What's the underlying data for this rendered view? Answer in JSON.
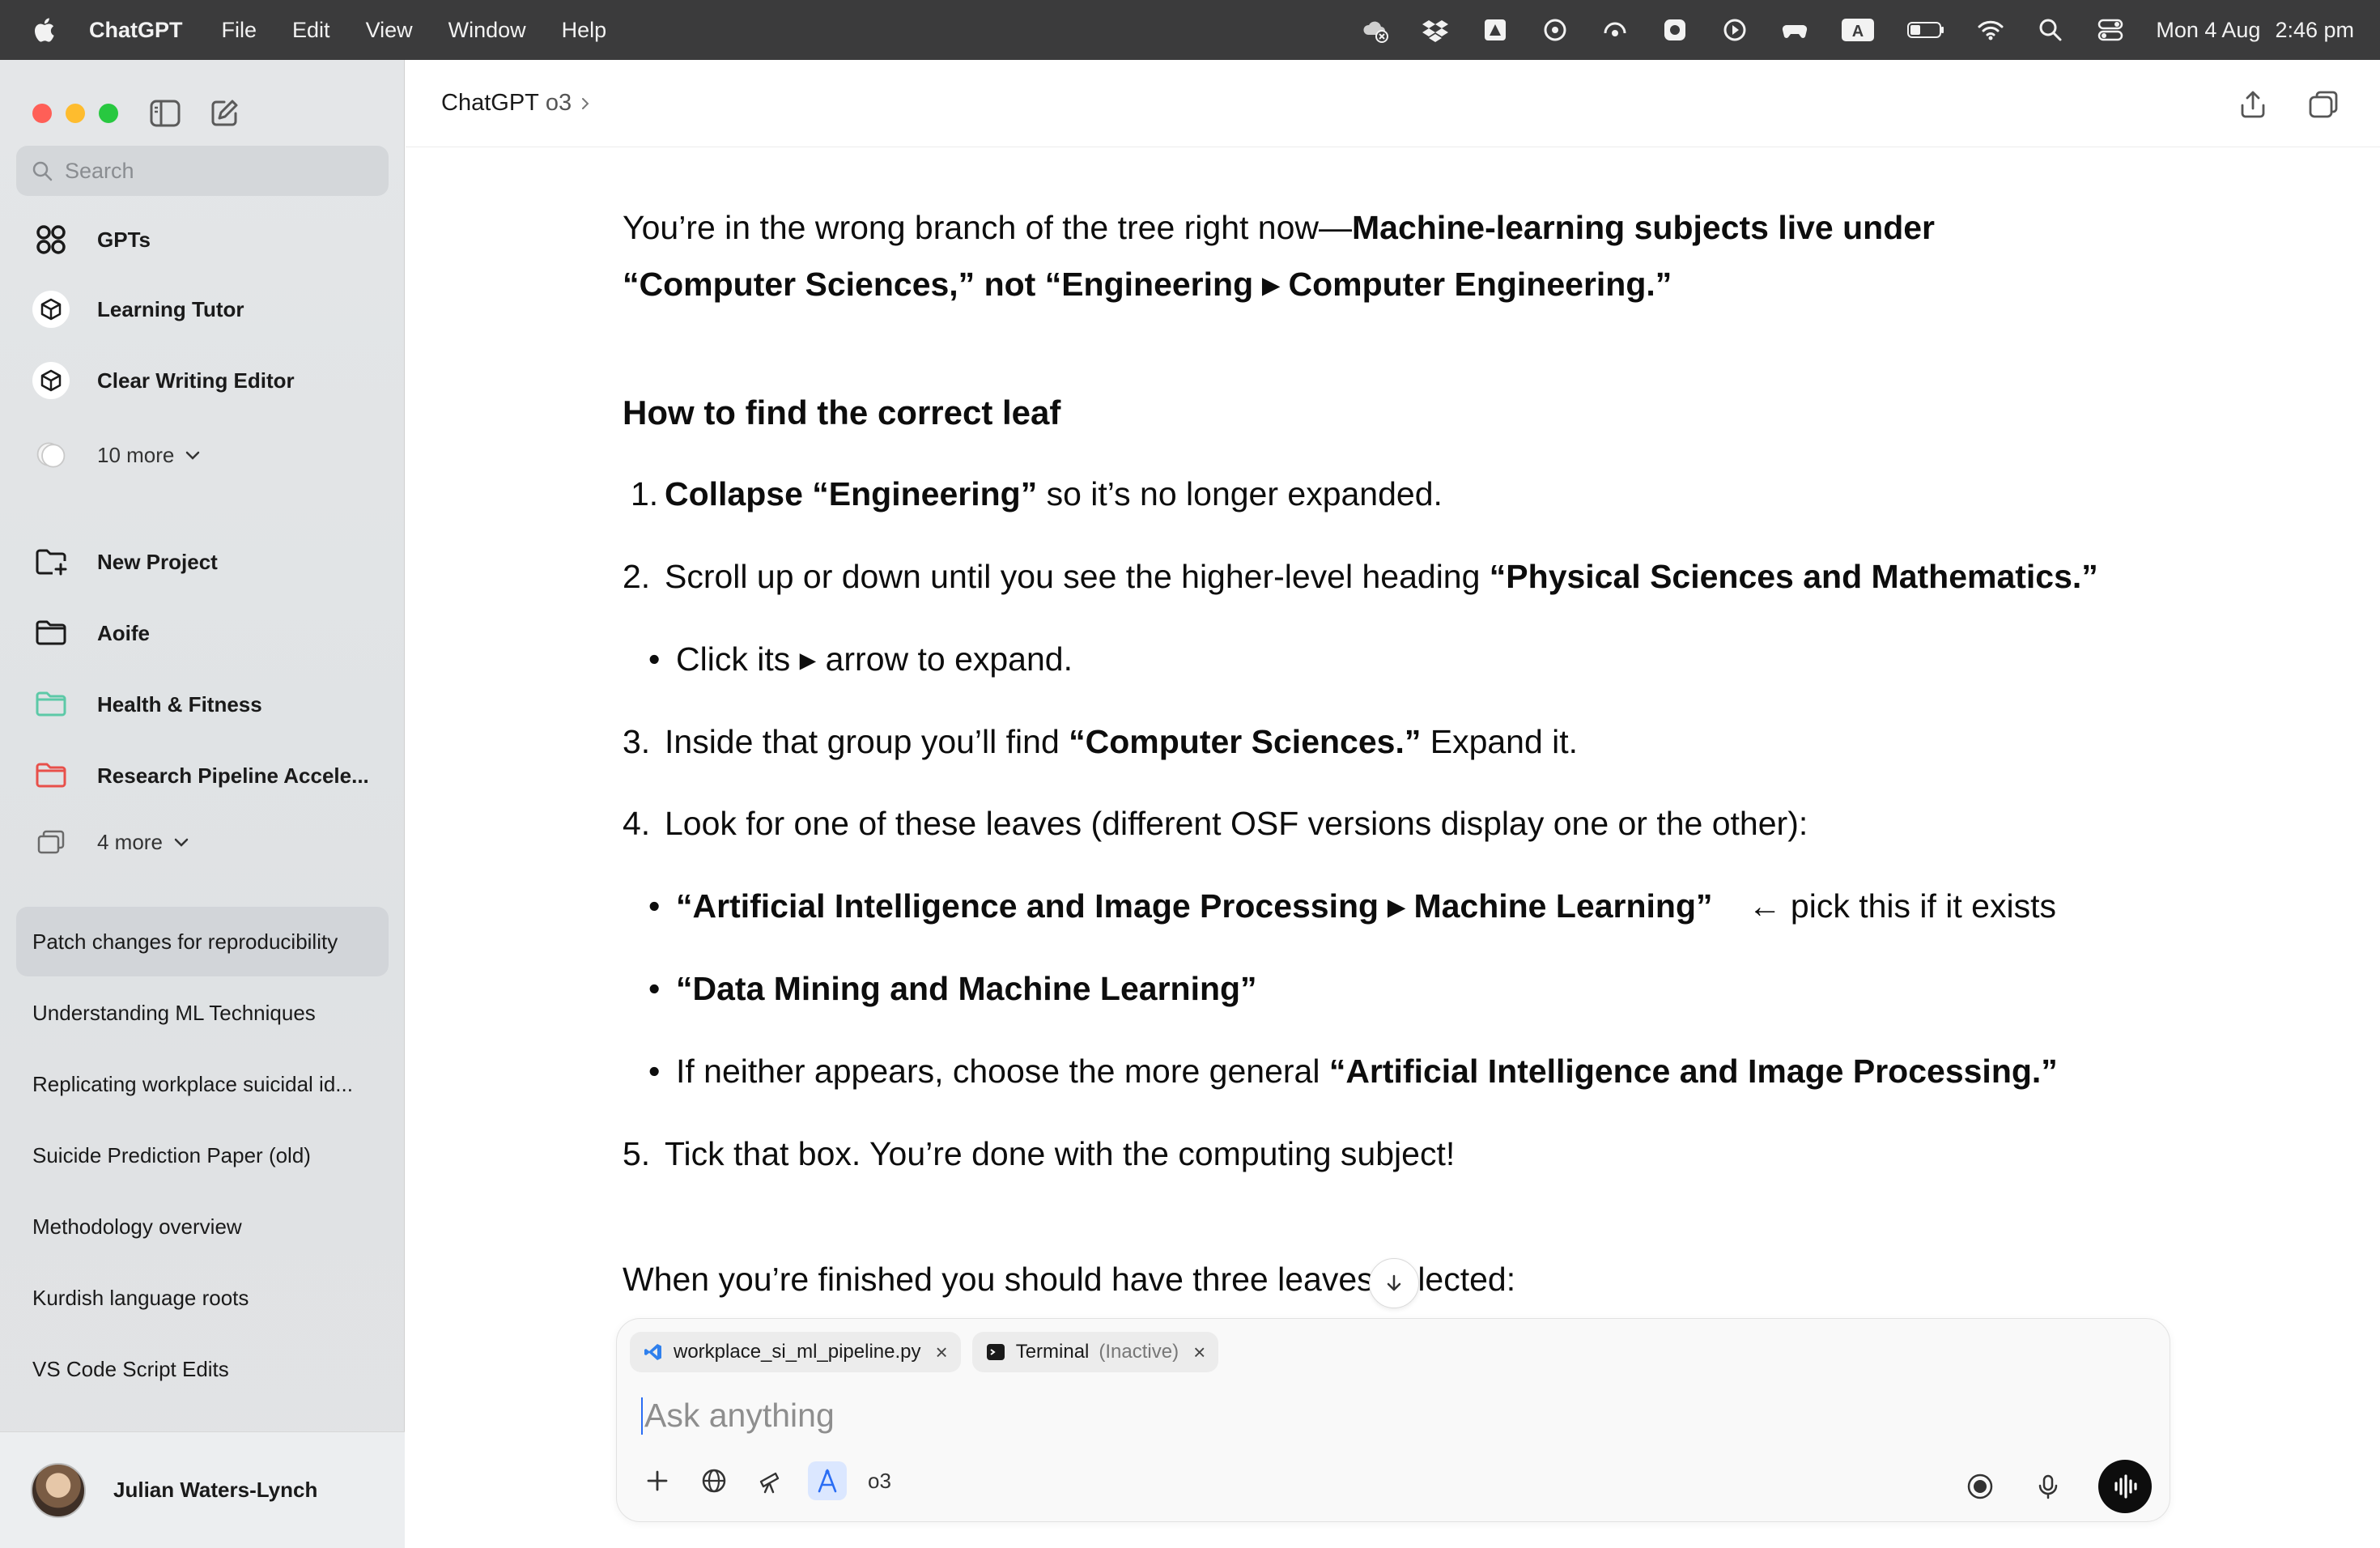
{
  "menubar": {
    "app_name": "ChatGPT",
    "menus": [
      "File",
      "Edit",
      "View",
      "Window",
      "Help"
    ],
    "status_icons": [
      "cloud-off-icon",
      "dropbox-icon",
      "drive-icon",
      "threads-icon",
      "network-icon",
      "gear-badge-icon",
      "play-icon",
      "gamepad-icon",
      "input-source-icon",
      "battery-icon",
      "wifi-icon",
      "spotlight-icon",
      "control-center-icon"
    ],
    "input_source": "A",
    "date": "Mon 4 Aug",
    "time": "2:46 pm"
  },
  "sidebar": {
    "search_placeholder": "Search",
    "gpts_label": "GPTs",
    "custom_gpts": [
      "Learning Tutor",
      "Clear Writing Editor"
    ],
    "gpts_more": "10 more",
    "projects": [
      {
        "label": "New Project",
        "icon": "new-folder-icon",
        "color": "#1a1a1a"
      },
      {
        "label": "Aoife",
        "icon": "folder-icon",
        "color": "#1a1a1a"
      },
      {
        "label": "Health & Fitness",
        "icon": "folder-icon",
        "color": "#5cc9a7"
      },
      {
        "label": "Research Pipeline Accele...",
        "icon": "folder-icon",
        "color": "#e8504a"
      }
    ],
    "projects_more": "4 more",
    "chats": [
      "Patch changes for reproducibility",
      "Understanding ML Techniques",
      "Replicating workplace suicidal id...",
      "Suicide Prediction Paper (old)",
      "Methodology overview",
      "Kurdish language roots",
      "VS Code Script Edits"
    ],
    "active_chat_index": 0,
    "user_name": "Julian Waters-Lynch"
  },
  "header": {
    "title": "ChatGPT",
    "model": "o3"
  },
  "message": {
    "intro_plain": "You’re in the wrong branch of the tree right now—",
    "intro_bold": "Machine-learning subjects live under “Computer Sciences,” not “Engineering ▸ Computer Engineering.”",
    "heading": "How to find the correct leaf",
    "step1_num": "1.",
    "step1_bold": "Collapse “Engineering”",
    "step1_rest": " so it’s no longer expanded.",
    "step2_num": "2.",
    "step2_plain": "Scroll up or down until you see the higher-level heading ",
    "step2_bold": "“Physical Sciences and Mathematics.”",
    "step2_sub": "Click its ▸ arrow to expand.",
    "step3_num": "3.",
    "step3_plain": "Inside that group you’ll find ",
    "step3_bold": "“Computer Sciences.”",
    "step3_rest": " Expand it.",
    "step4_num": "4.",
    "step4_plain": "Look for one of these leaves (different OSF versions display one or the other):",
    "step4_opt1_bold": "“Artificial Intelligence and Image Processing ▸ Machine Learning”",
    "step4_opt1_note": "← pick this if it exists",
    "step4_opt2_bold": "“Data Mining and Machine Learning”",
    "step4_opt3_plain": "If neither appears, choose the more general ",
    "step4_opt3_bold": "“Artificial Intelligence and Image Processing.”",
    "step5_num": "5.",
    "step5_plain": "Tick that box. You’re done with the computing subject!",
    "closing": "When you’re finished you should have three leaves selected:"
  },
  "composer": {
    "attachments": [
      {
        "label": "workplace_si_ml_pipeline.py",
        "icon": "vscode-icon",
        "suffix": ""
      },
      {
        "label": "Terminal",
        "icon": "terminal-icon",
        "suffix": "(Inactive)"
      }
    ],
    "placeholder": "Ask anything",
    "model": "o3"
  }
}
